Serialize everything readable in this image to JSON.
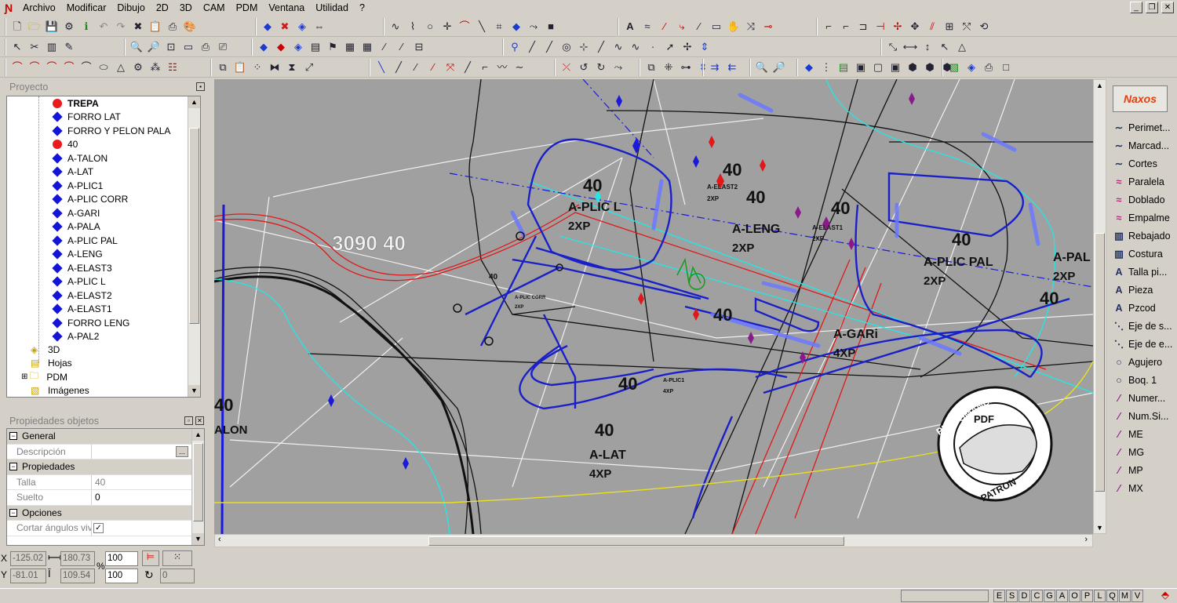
{
  "menu": [
    "Archivo",
    "Modificar",
    "Dibujo",
    "2D",
    "3D",
    "CAM",
    "PDM",
    "Ventana",
    "Utilidad",
    "?"
  ],
  "project": {
    "title": "Proyecto",
    "items": [
      {
        "label": "TREPA",
        "bold": true,
        "marker": "red"
      },
      {
        "label": "FORRO LAT",
        "marker": "blue"
      },
      {
        "label": "FORRO Y PELON PALA",
        "marker": "blue"
      },
      {
        "label": "40",
        "marker": "red"
      },
      {
        "label": "A-TALON",
        "marker": "blue"
      },
      {
        "label": "A-LAT",
        "marker": "blue"
      },
      {
        "label": "A-PLIC1",
        "marker": "blue"
      },
      {
        "label": "A-PLIC CORR",
        "marker": "blue"
      },
      {
        "label": "A-GARI",
        "marker": "blue"
      },
      {
        "label": "A-PALA",
        "marker": "blue"
      },
      {
        "label": "A-PLIC PAL",
        "marker": "blue"
      },
      {
        "label": "A-LENG",
        "marker": "blue"
      },
      {
        "label": "A-ELAST3",
        "marker": "blue"
      },
      {
        "label": "A-PLIC L",
        "marker": "blue"
      },
      {
        "label": "A-ELAST2",
        "marker": "blue"
      },
      {
        "label": "A-ELAST1",
        "marker": "blue"
      },
      {
        "label": "FORRO  LENG",
        "marker": "blue"
      },
      {
        "label": "A-PAL2",
        "marker": "blue"
      }
    ],
    "folders": [
      "3D",
      "Hojas",
      "PDM",
      "Imágenes"
    ]
  },
  "properties": {
    "title": "Propiedades objetos",
    "sections": [
      {
        "label": "General",
        "rows": [
          {
            "key": "Descripción",
            "value": ""
          }
        ]
      },
      {
        "label": "Propiedades",
        "rows": [
          {
            "key": "Talla",
            "value": "40"
          },
          {
            "key": "Suelto",
            "value": "0"
          }
        ]
      },
      {
        "label": "Opciones",
        "rows": [
          {
            "key": "Cortar ángulos vivos",
            "value": "✓"
          }
        ]
      }
    ]
  },
  "coords": {
    "x": "-125.02",
    "y": "-81.01",
    "dx": "180.73",
    "dy": "109.54",
    "sx": "100",
    "sy": "100",
    "rot": "0"
  },
  "right_panel": {
    "logo": "Naxos",
    "tools": [
      {
        "label": "Perimet...",
        "icon": "∼"
      },
      {
        "label": "Marcad...",
        "icon": "∼"
      },
      {
        "label": "Cortes",
        "icon": "∼"
      },
      {
        "label": "Paralela",
        "icon": "≈"
      },
      {
        "label": "Doblado",
        "icon": "≈"
      },
      {
        "label": "Empalme",
        "icon": "≈"
      },
      {
        "label": "Rebajado",
        "icon": "▥"
      },
      {
        "label": "Costura",
        "icon": "▥"
      },
      {
        "label": "Talla pi...",
        "icon": "A"
      },
      {
        "label": "Pieza",
        "icon": "A"
      },
      {
        "label": "Pzcod",
        "icon": "A"
      },
      {
        "label": "Eje de s...",
        "icon": "⋱"
      },
      {
        "label": "Eje de e...",
        "icon": "⋱"
      },
      {
        "label": "Agujero",
        "icon": "○"
      },
      {
        "label": "Boq. 1",
        "icon": "○"
      },
      {
        "label": "Numer...",
        "icon": "⁄"
      },
      {
        "label": "Num.Si...",
        "icon": "⁄"
      },
      {
        "label": "ME",
        "icon": "⁄"
      },
      {
        "label": "MG",
        "icon": "⁄"
      },
      {
        "label": "MP",
        "icon": "⁄"
      },
      {
        "label": "MX",
        "icon": "⁄"
      }
    ]
  },
  "status_letters": [
    "E",
    "S",
    "D",
    "C",
    "G",
    "A",
    "O",
    "P",
    "L",
    "Q",
    "M",
    "V"
  ],
  "drawing_labels": {
    "size_big": "3090  40",
    "t40": "40",
    "plicl": "A-PLIC L",
    "xp2": "2XP",
    "xp4": "4XP",
    "leng": "A-LENG",
    "elast2": "A-ELAST2",
    "elast1": "A-ELAST1",
    "plicpal": "A-PLIC PAL",
    "pal": "A-PAL",
    "gari": "A-GARi",
    "plic1": "A-PLIC1",
    "plicorr": "A-PLIC CORR",
    "lat": "A-LAT",
    "talon": "ALON",
    "stamp_top": "PERFOMANCE",
    "stamp_mid": "PDF",
    "stamp_bot": "PATRON"
  }
}
